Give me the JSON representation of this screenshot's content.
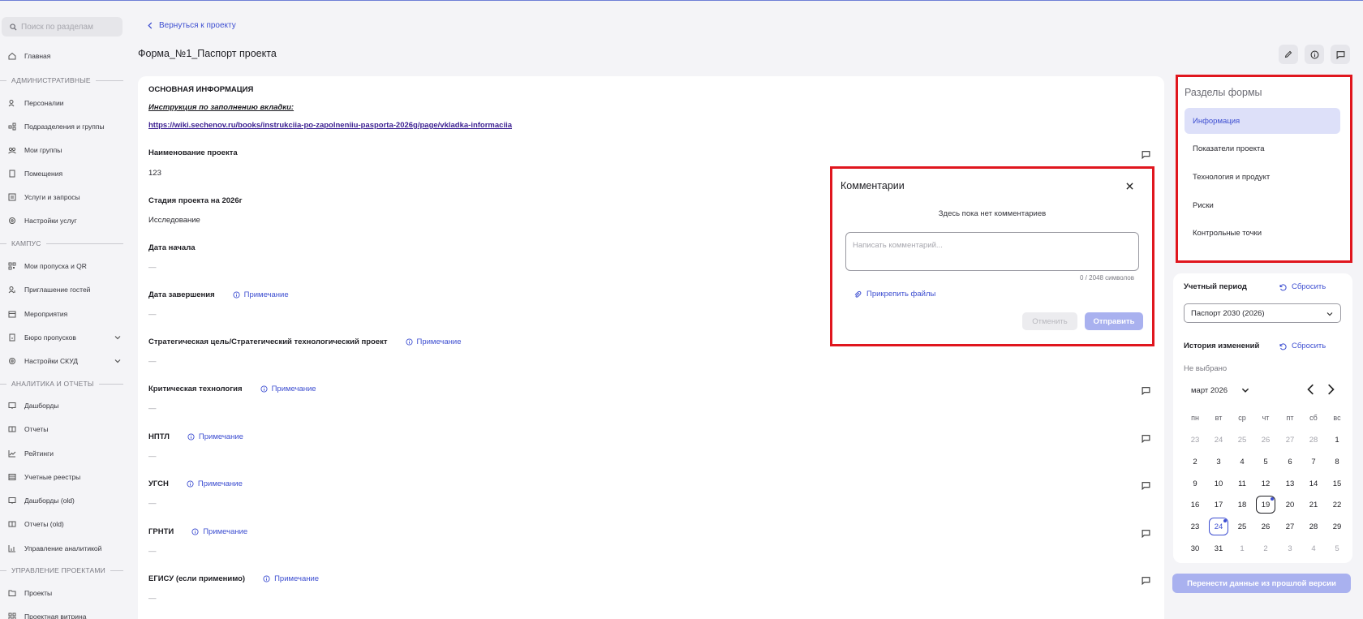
{
  "search": {
    "placeholder": "Поиск по разделам"
  },
  "sidebar": {
    "items": [
      {
        "label": "Главная",
        "icon": "home-icon"
      },
      {
        "label": "Персоналии",
        "icon": "people-icon"
      },
      {
        "label": "Подразделения и группы",
        "icon": "org-icon"
      },
      {
        "label": "Мои группы",
        "icon": "groups-icon"
      },
      {
        "label": "Помещения",
        "icon": "door-icon"
      },
      {
        "label": "Услуги и запросы",
        "icon": "services-icon"
      },
      {
        "label": "Настройки услуг",
        "icon": "gear-icon"
      },
      {
        "label": "Мои пропуска и QR",
        "icon": "qr-icon"
      },
      {
        "label": "Приглашение гостей",
        "icon": "guest-icon"
      },
      {
        "label": "Мероприятия",
        "icon": "calendar-icon"
      },
      {
        "label": "Бюро пропусков",
        "icon": "badge-icon"
      },
      {
        "label": "Настройки СКУД",
        "icon": "gear-icon"
      },
      {
        "label": "Дашборды",
        "icon": "dashboard-icon"
      },
      {
        "label": "Отчеты",
        "icon": "report-icon"
      },
      {
        "label": "Рейтинги",
        "icon": "chart-icon"
      },
      {
        "label": "Учетные реестры",
        "icon": "registry-icon"
      },
      {
        "label": "Дашборды (old)",
        "icon": "dashboard-icon"
      },
      {
        "label": "Отчеты (old)",
        "icon": "report-icon"
      },
      {
        "label": "Управление аналитикой",
        "icon": "chart-icon"
      },
      {
        "label": "Проекты",
        "icon": "folder-icon"
      },
      {
        "label": "Проектная витрина",
        "icon": "grid-icon"
      }
    ],
    "sections": [
      "АДМИНИСТРАТИВНЫЕ",
      "КАМПУС",
      "АНАЛИТИКА И ОТЧЕТЫ",
      "УПРАВЛЕНИЕ ПРОЕКТАМИ"
    ]
  },
  "header": {
    "back_label": "Вернуться к проекту",
    "title": "Форма_№1_Паспорт проекта"
  },
  "form": {
    "section_title": "ОСНОВНАЯ ИНФОРМАЦИЯ",
    "instruction": "Инструкция по заполнению вкладки:",
    "link": "https://wiki.sechenov.ru/books/instrukciia-po-zapolneniiu-pasporta-2026g/page/vkladka-informaciia",
    "note_label": "Примечание",
    "fields": [
      {
        "label": "Наименование проекта",
        "value": "123"
      },
      {
        "label": "Стадия проекта на 2026г",
        "value": "Исследование"
      },
      {
        "label": "Дата начала",
        "value": "—"
      },
      {
        "label": "Дата завершения",
        "value": "—"
      },
      {
        "label": "Стратегическая цель/Стратегический технологический проект",
        "value": "—"
      },
      {
        "label": "Критическая технология",
        "value": "—"
      },
      {
        "label": "НПТЛ",
        "value": "—"
      },
      {
        "label": "УГСН",
        "value": "—"
      },
      {
        "label": "ГРНТИ",
        "value": "—"
      },
      {
        "label": "ЕГИСУ (если применимо)",
        "value": "—"
      }
    ]
  },
  "comments": {
    "title": "Комментарии",
    "empty": "Здесь пока нет комментариев",
    "placeholder": "Написать комментарий...",
    "counter": "0 / 2048 символов",
    "attach": "Прикрепить файлы",
    "cancel": "Отменить",
    "send": "Отправить"
  },
  "sections_panel": {
    "title": "Разделы формы",
    "items": [
      "Информация",
      "Показатели проекта",
      "Технология и продукт",
      "Риски",
      "Контрольные точки"
    ],
    "active": "Информация"
  },
  "period": {
    "label": "Учетный период",
    "reset": "Сбросить",
    "selected": "Паспорт 2030 (2026)",
    "history_label": "История изменений",
    "history_reset": "Сбросить",
    "not_selected": "Не выбрано",
    "month": "март 2026",
    "weekdays": [
      "пн",
      "вт",
      "ср",
      "чт",
      "пт",
      "сб",
      "вс"
    ],
    "weeks": [
      [
        "23",
        "24",
        "25",
        "26",
        "27",
        "28",
        "1"
      ],
      [
        "2",
        "3",
        "4",
        "5",
        "6",
        "7",
        "8"
      ],
      [
        "9",
        "10",
        "11",
        "12",
        "13",
        "14",
        "15"
      ],
      [
        "16",
        "17",
        "18",
        "19",
        "20",
        "21",
        "22"
      ],
      [
        "23",
        "24",
        "25",
        "26",
        "27",
        "28",
        "29"
      ],
      [
        "30",
        "31",
        "1",
        "2",
        "3",
        "4",
        "5"
      ]
    ],
    "today": "19",
    "selected_day": "24"
  },
  "transfer_button": "Перенести данные из прошлой версии",
  "colors": {
    "accent": "#3e4fd1",
    "highlight": "#e0161e",
    "active_bg": "#dde0f9"
  }
}
